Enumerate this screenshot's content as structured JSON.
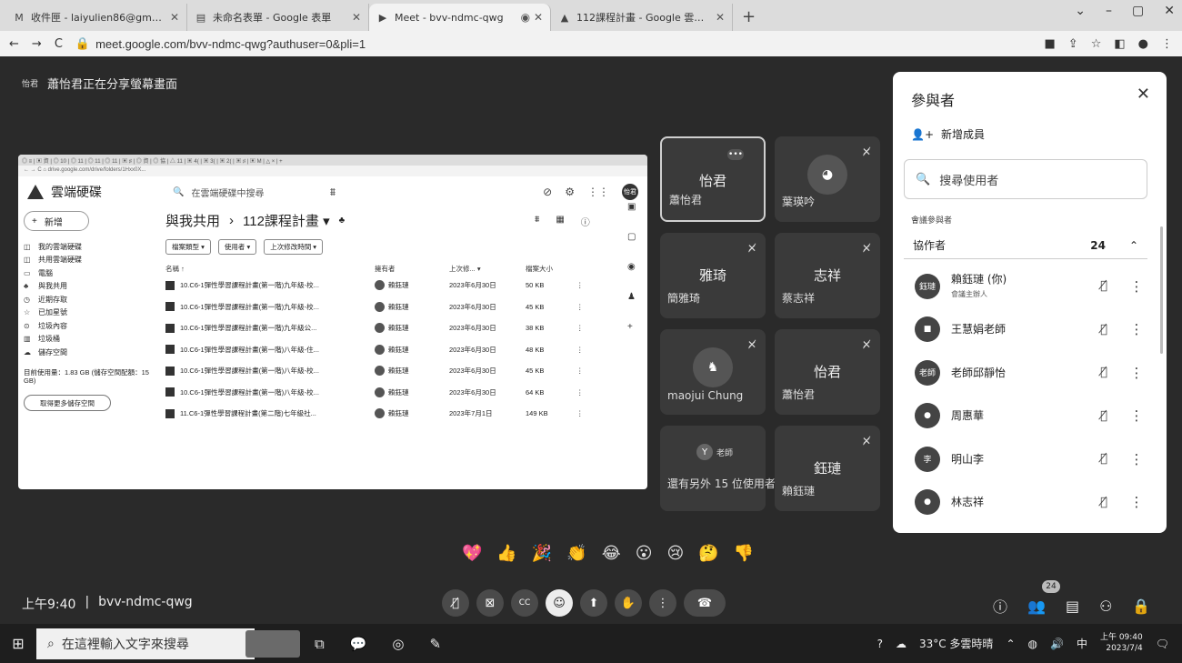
{
  "browser": {
    "tabs": [
      {
        "icon": "M",
        "title": "收件匣 - laiyulien86@gmail.co",
        "active": false
      },
      {
        "icon": "▤",
        "title": "未命名表單 - Google 表單",
        "active": false
      },
      {
        "icon": "▶",
        "title": "Meet - bvv-ndmc-qwg",
        "active": true
      },
      {
        "icon": "▲",
        "title": "112課程計畫 - Google 雲端硬碟",
        "active": false
      }
    ],
    "new_tab": "+",
    "url": "meet.google.com/bvv-ndmc-qwg?authuser=0&pli=1"
  },
  "meet": {
    "presenting_badge": "怡君",
    "presenting_text": "蕭怡君正在分享螢幕畫面",
    "meeting_time": "上午9:40",
    "meeting_code": "bvv-ndmc-qwg",
    "reactions": [
      "💖",
      "👍",
      "🎉",
      "👏",
      "😂",
      "😮",
      "😢",
      "🤔",
      "👎"
    ],
    "participant_count": "24"
  },
  "shared_screen": {
    "tabs_line": "◎ ≡ | ▣ 資 | ◎ 10 | ◎ 11 | ◎ 11 | ◎ 11 | ▣ ♯ | ◎ 資 | ◎ 協 | △ 11 | ▣ 4( | ▣ 3( | ▣ 2( | ▣ ♯ | ▣ M | △ × | +",
    "addr_line": "← → C ⌂  drive.google.com/drive/folders/1Hxx0X...",
    "logo": "雲端硬碟",
    "search_placeholder": "在雲端硬碟中搜尋",
    "avatar": "怡君",
    "new_button": "新增",
    "nav": [
      {
        "icon": "◫",
        "label": "我的雲端硬碟"
      },
      {
        "icon": "◫",
        "label": "共用雲端硬碟"
      },
      {
        "icon": "▭",
        "label": "電腦"
      },
      {
        "icon": "♣",
        "label": "與我共用"
      },
      {
        "icon": "◷",
        "label": "近期存取"
      },
      {
        "icon": "☆",
        "label": "已加星號"
      },
      {
        "icon": "⊙",
        "label": "垃圾內容"
      },
      {
        "icon": "▥",
        "label": "垃圾桶"
      },
      {
        "icon": "☁",
        "label": "儲存空間"
      }
    ],
    "storage_text": "目前使用量：1.83 GB (儲存空間配額：15 GB)",
    "get_more": "取得更多儲存空間",
    "breadcrumb_root": "與我共用",
    "breadcrumb_sep": "›",
    "breadcrumb_folder": "112課程計畫 ▾",
    "filters": [
      "檔案類型 ▾",
      "使用者 ▾",
      "上次修改時間 ▾"
    ],
    "columns": {
      "name": "名稱 ↑",
      "owner": "擁有者",
      "modified": "上次修... ▾",
      "size": "檔案大小"
    },
    "files": [
      {
        "name": "10.C6-1彈性學習課程計畫(第一階)九年級-校...",
        "owner": "賴鈺璉",
        "modified": "2023年6月30日",
        "size": "50 KB"
      },
      {
        "name": "10.C6-1彈性學習課程計畫(第一階)九年級-校...",
        "owner": "賴鈺璉",
        "modified": "2023年6月30日",
        "size": "45 KB"
      },
      {
        "name": "10.C6-1彈性學習課程計畫(第一階)九年級公...",
        "owner": "賴鈺璉",
        "modified": "2023年6月30日",
        "size": "38 KB"
      },
      {
        "name": "10.C6-1彈性學習課程計畫(第一階)八年級-住...",
        "owner": "賴鈺璉",
        "modified": "2023年6月30日",
        "size": "48 KB"
      },
      {
        "name": "10.C6-1彈性學習課程計畫(第一階)八年級-校...",
        "owner": "賴鈺璉",
        "modified": "2023年6月30日",
        "size": "45 KB"
      },
      {
        "name": "10.C6-1彈性學習課程計畫(第一階)八年級-校...",
        "owner": "賴鈺璉",
        "modified": "2023年6月30日",
        "size": "64 KB"
      },
      {
        "name": "11.C6-1彈性學習課程計畫(第二階)七年級社...",
        "owner": "賴鈺璉",
        "modified": "2023年7月1日",
        "size": "149 KB"
      }
    ]
  },
  "tiles": [
    {
      "center": "怡君",
      "name": "蕭怡君",
      "highlight": true,
      "more": "•••"
    },
    {
      "center": "",
      "name": "葉瑛吟",
      "mic": "🎙"
    },
    {
      "center": "雅琦",
      "name": "簡雅琦",
      "mic": "🎙"
    },
    {
      "center": "志祥",
      "name": "蔡志祥",
      "mic": "🎙"
    },
    {
      "center": "",
      "name": "maojui Chung",
      "mic": "🎙"
    },
    {
      "center": "怡君",
      "name": "蕭怡君",
      "mic": "🎙"
    },
    {
      "center": "Y",
      "badge_label": "老師",
      "name": "還有另外 15 位使用者"
    },
    {
      "center": "鈺璉",
      "name": "賴鈺璉",
      "mic": "🎙"
    }
  ],
  "panel": {
    "title": "參與者",
    "close": "✕",
    "add_label": "新增成員",
    "search_placeholder": "搜尋使用者",
    "section": "會議參與者",
    "group_label": "協作者",
    "group_count": "24",
    "group_toggle": "⌃",
    "participants": [
      {
        "avatar": "鈺璉",
        "name": "賴鈺璉 (你)",
        "sub": "會議主辦人"
      },
      {
        "avatar": "■",
        "name": "王慧娟老師",
        "sub": ""
      },
      {
        "avatar": "老師",
        "name": "老師邱靜怡",
        "sub": ""
      },
      {
        "avatar": "●",
        "name": "周惠華",
        "sub": ""
      },
      {
        "avatar": "李",
        "name": "明山李",
        "sub": ""
      },
      {
        "avatar": "●",
        "name": "林志祥",
        "sub": ""
      }
    ]
  },
  "taskbar": {
    "search_placeholder": "在這裡輸入文字來搜尋",
    "weather": "33°C 多雲時晴",
    "ime": "中",
    "time": "上午 09:40",
    "date": "2023/7/4"
  }
}
